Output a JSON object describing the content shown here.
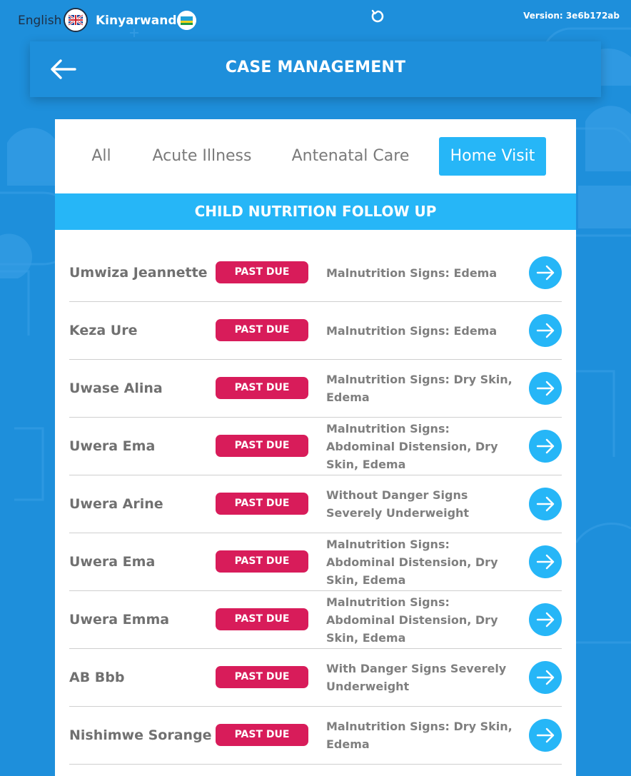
{
  "topbar": {
    "lang_en": "English",
    "lang_rw": "Kinyarwanda",
    "version": "Version: 3e6b172ab"
  },
  "header": {
    "title": "CASE MANAGEMENT"
  },
  "tabs": [
    {
      "label": "All",
      "active": false
    },
    {
      "label": "Acute Illness",
      "active": false
    },
    {
      "label": "Antenatal Care",
      "active": false
    },
    {
      "label": "Home Visit",
      "active": true
    }
  ],
  "section_title": "CHILD NUTRITION FOLLOW UP",
  "rows": [
    {
      "name": "Umwiza Jeannette",
      "status": "PAST DUE",
      "description": "Malnutrition Signs: Edema"
    },
    {
      "name": "Keza Ure",
      "status": "PAST DUE",
      "description": "Malnutrition Signs: Edema"
    },
    {
      "name": "Uwase Alina",
      "status": "PAST DUE",
      "description": "Malnutrition Signs: Dry Skin, Edema"
    },
    {
      "name": "Uwera Ema",
      "status": "PAST DUE",
      "description": "Malnutrition Signs: Abdominal Distension, Dry Skin, Edema"
    },
    {
      "name": "Uwera Arine",
      "status": "PAST DUE",
      "description": "Without Danger Signs Severely Underweight"
    },
    {
      "name": "Uwera Ema",
      "status": "PAST DUE",
      "description": "Malnutrition Signs: Abdominal Distension, Dry Skin, Edema"
    },
    {
      "name": "Uwera Emma",
      "status": "PAST DUE",
      "description": "Malnutrition Signs: Abdominal Distension, Dry Skin, Edema"
    },
    {
      "name": "AB Bbb",
      "status": "PAST DUE",
      "description": "With Danger Signs Severely Underweight"
    },
    {
      "name": "Nishimwe Sorange",
      "status": "PAST DUE",
      "description": "Malnutrition Signs: Dry Skin, Edema"
    }
  ],
  "colors": {
    "background": "#1e8fdb",
    "accent": "#26b6f7",
    "past_due": "#d81c5a"
  }
}
